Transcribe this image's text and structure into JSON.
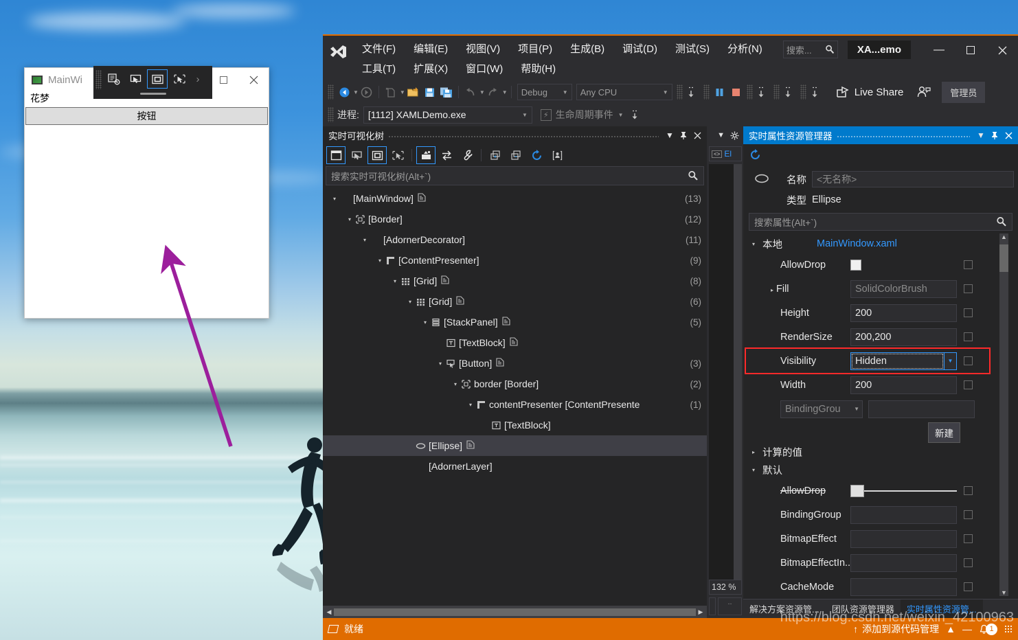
{
  "desktop": {
    "wallpaper_alt": "beach-sunset-runner"
  },
  "annotation": {
    "arrow_color": "#9c1f9c"
  },
  "app_window": {
    "title": "MainWi",
    "text_block": "花梦",
    "button_label": "按钮",
    "close_icon": "close-icon",
    "restore_icon": "restore-icon",
    "inapp_toolbar": {
      "icons": [
        "go-to-live-visual-tree-icon",
        "select-element-icon",
        "display-layout-adorner-icon",
        "track-focus-icon"
      ],
      "chevron": "›"
    }
  },
  "vs": {
    "logo": "visual-studio-logo",
    "menus_row1": [
      {
        "label": "文件(F)",
        "accel": "F"
      },
      {
        "label": "编辑(E)",
        "accel": "E"
      },
      {
        "label": "视图(V)",
        "accel": "V"
      },
      {
        "label": "项目(P)",
        "accel": "P"
      },
      {
        "label": "生成(B)",
        "accel": "B"
      },
      {
        "label": "调试(D)",
        "accel": "D"
      },
      {
        "label": "测试(S)",
        "accel": "S"
      },
      {
        "label": "分析(N)",
        "accel": "N"
      }
    ],
    "menus_row2": [
      {
        "label": "工具(T)",
        "accel": "T"
      },
      {
        "label": "扩展(X)",
        "accel": "X"
      },
      {
        "label": "窗口(W)",
        "accel": "W"
      },
      {
        "label": "帮助(H)",
        "accel": "H"
      }
    ],
    "search_placeholder": "搜索...",
    "document_name": "XA...emo",
    "window_buttons": {
      "minimize": "—",
      "maximize": "▢",
      "close": "✕"
    },
    "toolbar": {
      "back_icon": "navigate-back-icon",
      "forward_icon": "navigate-forward-icon",
      "new_item_icon": "new-item-icon",
      "open_icon": "open-file-icon",
      "save_icon": "save-icon",
      "save_all_icon": "save-all-icon",
      "undo_icon": "undo-icon",
      "redo_icon": "redo-icon",
      "config_value": "Debug",
      "platform_value": "Any CPU",
      "step_over_icon": "step-over-icon",
      "pause_icon": "pause-icon",
      "stop_icon": "stop-icon",
      "step_into_icon": "step-into-icon",
      "step_out_icon": "step-out-icon",
      "live_share_label": "Live Share",
      "live_share_icon": "share-icon",
      "account_icon": "account-icon",
      "admin_label": "管理员"
    },
    "process_bar": {
      "label": "进程:",
      "value": "[1112] XAMLDemo.exe",
      "lifecycle_icon": "lifecycle-events-icon",
      "lifecycle_label": "生命周期事件",
      "thread_icon": "threads-icon"
    },
    "live_visual_tree": {
      "title": "实时可视化树",
      "dropdown_icon": "chevron-down-icon",
      "pin_icon": "pin-icon",
      "close_icon": "close-icon",
      "tools": [
        {
          "name": "select-in-window-icon",
          "selected": true
        },
        {
          "name": "preview-selection-icon",
          "selected": false
        },
        {
          "name": "display-layout-adorner-icon",
          "selected": true
        },
        {
          "name": "track-focus-icon",
          "selected": false
        },
        {
          "name": "show-in-tree-icon",
          "selected": true
        },
        {
          "name": "sync-icon",
          "selected": false
        },
        {
          "name": "settings-wrench-icon",
          "selected": false
        },
        {
          "name": "expand-all-icon",
          "selected": false
        },
        {
          "name": "collapse-all-icon",
          "selected": false
        },
        {
          "name": "refresh-icon",
          "selected": false
        },
        {
          "name": "show-properties-icon",
          "selected": false
        }
      ],
      "search_placeholder": "搜索实时可视化树(Alt+`)",
      "search_icon": "search-icon",
      "nodes": [
        {
          "indent": 0,
          "twisty": "▾",
          "icon": "",
          "label": "[MainWindow]",
          "doc": true,
          "count": "(13)",
          "selected": false
        },
        {
          "indent": 1,
          "twisty": "▾",
          "icon": "border-icon",
          "label": "[Border]",
          "doc": false,
          "count": "(12)",
          "selected": false
        },
        {
          "indent": 2,
          "twisty": "▾",
          "icon": "",
          "label": "[AdornerDecorator]",
          "doc": false,
          "count": "(11)",
          "selected": false
        },
        {
          "indent": 3,
          "twisty": "▾",
          "icon": "contentpresenter-icon",
          "label": "[ContentPresenter]",
          "doc": false,
          "count": "(9)",
          "selected": false
        },
        {
          "indent": 4,
          "twisty": "▾",
          "icon": "grid-icon",
          "label": "[Grid]",
          "doc": true,
          "count": "(8)",
          "selected": false
        },
        {
          "indent": 5,
          "twisty": "▾",
          "icon": "grid-icon",
          "label": "[Grid]",
          "doc": true,
          "count": "(6)",
          "selected": false
        },
        {
          "indent": 6,
          "twisty": "▾",
          "icon": "stackpanel-icon",
          "label": "[StackPanel]",
          "doc": true,
          "count": "(5)",
          "selected": false
        },
        {
          "indent": 7,
          "twisty": "",
          "icon": "textblock-icon",
          "label": "[TextBlock]",
          "doc": true,
          "count": "",
          "selected": false
        },
        {
          "indent": 7,
          "twisty": "▾",
          "icon": "button-icon",
          "label": "[Button]",
          "doc": true,
          "count": "(3)",
          "selected": false
        },
        {
          "indent": 8,
          "twisty": "▾",
          "icon": "border-icon",
          "label": "border [Border]",
          "doc": false,
          "count": "(2)",
          "selected": false
        },
        {
          "indent": 9,
          "twisty": "▾",
          "icon": "contentpresenter-icon",
          "label": "contentPresenter [ContentPresente",
          "doc": false,
          "count": "(1)",
          "selected": false
        },
        {
          "indent": 10,
          "twisty": "",
          "icon": "textblock-icon",
          "label": "[TextBlock]",
          "doc": false,
          "count": "",
          "selected": false
        },
        {
          "indent": 5,
          "twisty": "",
          "icon": "ellipse-icon",
          "label": "[Ellipse]",
          "doc": true,
          "count": "",
          "selected": true
        },
        {
          "indent": 5,
          "twisty": "",
          "icon": "",
          "label": "[AdornerLayer]",
          "doc": false,
          "count": "",
          "selected": false
        }
      ]
    },
    "editor_strip": {
      "collapse_icon": "collapse-icon",
      "gear_icon": "gear-icon",
      "tab_icon": "code-icon",
      "tab_label": "El",
      "zoom_level": "132 %"
    },
    "live_property_explorer": {
      "title": "实时属性资源管理器",
      "dropdown_icon": "chevron-down-icon",
      "pin_icon": "pin-icon",
      "close_icon": "close-icon",
      "refresh_icon": "refresh-icon",
      "element_icon": "ellipse-icon",
      "name_label": "名称",
      "name_value": "<无名称>",
      "type_label": "类型",
      "type_value": "Ellipse",
      "search_placeholder": "搜索属性(Alt+`)",
      "search_icon": "search-icon",
      "group_local": "本地",
      "source_file": "MainWindow.xaml",
      "local_properties": [
        {
          "name": "AllowDrop",
          "expandable": false,
          "editor": "checkbox-white",
          "value": "",
          "checked": false
        },
        {
          "name": "Fill",
          "expandable": true,
          "editor": "text",
          "value": "SolidColorBrush",
          "placeholder": true
        },
        {
          "name": "Height",
          "expandable": false,
          "editor": "text",
          "value": "200",
          "placeholder": false
        },
        {
          "name": "RenderSize",
          "expandable": false,
          "editor": "text",
          "value": "200,200",
          "placeholder": false
        },
        {
          "name": "Visibility",
          "expandable": false,
          "editor": "combo",
          "value": "Hidden",
          "placeholder": false,
          "highlighted": true,
          "focused": true
        },
        {
          "name": "Width",
          "expandable": false,
          "editor": "text",
          "value": "200",
          "placeholder": false
        }
      ],
      "add_property_combo": "BindingGrou",
      "add_property_value": "",
      "new_button": "新建",
      "group_computed": "计算的值",
      "group_default": "默认",
      "default_properties": [
        {
          "name": "AllowDrop",
          "editor": "slider",
          "value": "",
          "strikethrough": true
        },
        {
          "name": "BindingGroup",
          "editor": "text",
          "value": ""
        },
        {
          "name": "BitmapEffect",
          "editor": "text",
          "value": ""
        },
        {
          "name": "BitmapEffectIn...",
          "editor": "text",
          "value": ""
        },
        {
          "name": "CacheMode",
          "editor": "text",
          "value": ""
        }
      ],
      "tabs": [
        {
          "label": "解决方案资源管...",
          "active": false
        },
        {
          "label": "团队资源管理器",
          "active": false
        },
        {
          "label": "实时属性资源管...",
          "active": true
        }
      ]
    },
    "status_bar": {
      "icon": "ready-icon",
      "text": "就绪",
      "source_control_icon": "upload-icon",
      "source_control_label": "添加到源代码管理",
      "expand_icon": "▲",
      "minimize_icon": "—",
      "bell_icon": "bell-icon",
      "notification_count": "1",
      "grip_icon": "resize-grip-icon"
    },
    "watermark": "https://blog.csdn.net/weixin_42100963"
  }
}
